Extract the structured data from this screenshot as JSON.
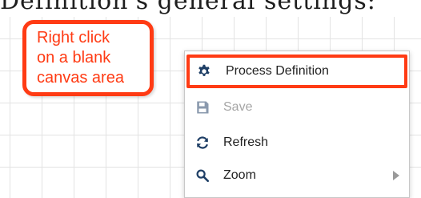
{
  "heading": {
    "partial_text": "Definition's general settings:"
  },
  "callout": {
    "lines": [
      "Right click",
      "on a blank",
      "canvas area"
    ],
    "color": "#ff3b14"
  },
  "context_menu": {
    "items": [
      {
        "label": "Process Definition",
        "icon": "gear-icon",
        "enabled": true,
        "highlighted": true
      },
      {
        "label": "Save",
        "icon": "floppy-disk-icon",
        "enabled": false
      },
      {
        "label": "Refresh",
        "icon": "refresh-icon",
        "enabled": true
      },
      {
        "label": "Zoom",
        "icon": "magnifier-icon",
        "enabled": true,
        "has_submenu": true
      }
    ]
  }
}
